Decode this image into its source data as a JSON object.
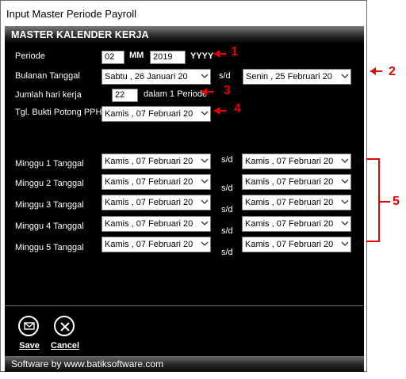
{
  "window": {
    "title": "Input Master Periode Payroll",
    "panel_header": "MASTER KALENDER KERJA",
    "status_text": "Software by www.batiksoftware.com"
  },
  "form": {
    "periode": {
      "label": "Periode",
      "month_value": "02",
      "month_unit": "MM",
      "year_value": "2019",
      "year_unit": "YYYY"
    },
    "bulanan": {
      "label": "Bulanan Tanggal",
      "from": "Sabtu , 26   Januari   20",
      "sd": "s/d",
      "to": "Senin , 25   Februari  20"
    },
    "jumlah": {
      "label": "Jumlah hari kerja",
      "value": "22",
      "suffix": "dalam 1 Periode"
    },
    "bukti": {
      "label": "Tgl. Bukti Potong PPH",
      "value": "Kamis , 07   Februari  20"
    },
    "weeks": [
      {
        "label": "Minggu 1 Tanggal",
        "from": "Kamis , 07   Februari  20",
        "sd": "s/d",
        "to": "Kamis , 07   Februari  20"
      },
      {
        "label": "Minggu 2 Tanggal",
        "from": "Kamis , 07   Februari  20",
        "sd": "s/d",
        "to": "Kamis , 07   Februari  20"
      },
      {
        "label": "Minggu 3 Tanggal",
        "from": "Kamis , 07   Februari  20",
        "sd": "s/d",
        "to": "Kamis , 07   Februari  20"
      },
      {
        "label": "Minggu 4 Tanggal",
        "from": "Kamis , 07   Februari  20",
        "sd": "s/d",
        "to": "Kamis , 07   Februari  20"
      },
      {
        "label": "Minggu 5 Tanggal",
        "from": "Kamis , 07   Februari  20",
        "sd": "s/d",
        "to": "Kamis , 07   Februari  20"
      }
    ]
  },
  "buttons": {
    "save_label": "Save",
    "save_icon": "envelope-icon",
    "cancel_label": "Cancel",
    "cancel_icon": "close-icon"
  },
  "annotations": {
    "n1": "1",
    "n2": "2",
    "n3": "3",
    "n4": "4",
    "n5": "5",
    "color": "#e50000"
  }
}
